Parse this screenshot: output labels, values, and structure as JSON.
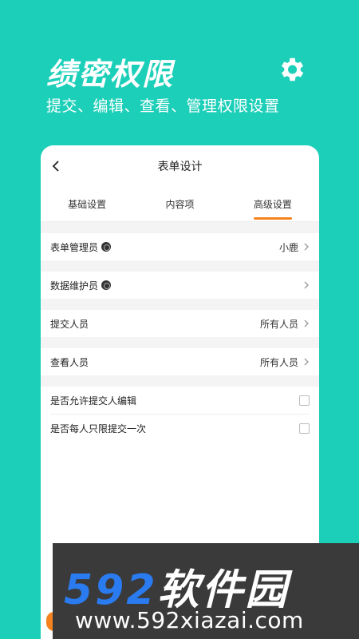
{
  "hero": {
    "title": "绩密权限",
    "subtitle": "提交、编辑、查看、管理权限设置",
    "settings_icon": "gear-icon"
  },
  "card": {
    "nav_title": "表单设计",
    "tabs": [
      {
        "label": "基础设置",
        "active": false
      },
      {
        "label": "内容项",
        "active": false
      },
      {
        "label": "高级设置",
        "active": true
      }
    ],
    "rows": {
      "form_admin": {
        "label": "表单管理员",
        "value": "小鹿"
      },
      "data_maintainer": {
        "label": "数据维护员",
        "value": ""
      },
      "submitter": {
        "label": "提交人员",
        "value": "所有人员"
      },
      "viewer": {
        "label": "查看人员",
        "value": "所有人员"
      },
      "allow_edit": {
        "label": "是否允许提交人编辑",
        "checked": false
      },
      "once_only": {
        "label": "是否每人只限提交一次",
        "checked": false
      }
    }
  },
  "watermark": {
    "brand_number": "592",
    "brand_text": "软件园",
    "url": "www.592xiazai.com"
  },
  "colors": {
    "background": "#1ccfb8",
    "accent": "#f5821f",
    "watermark_blue": "#2a7bf0"
  }
}
